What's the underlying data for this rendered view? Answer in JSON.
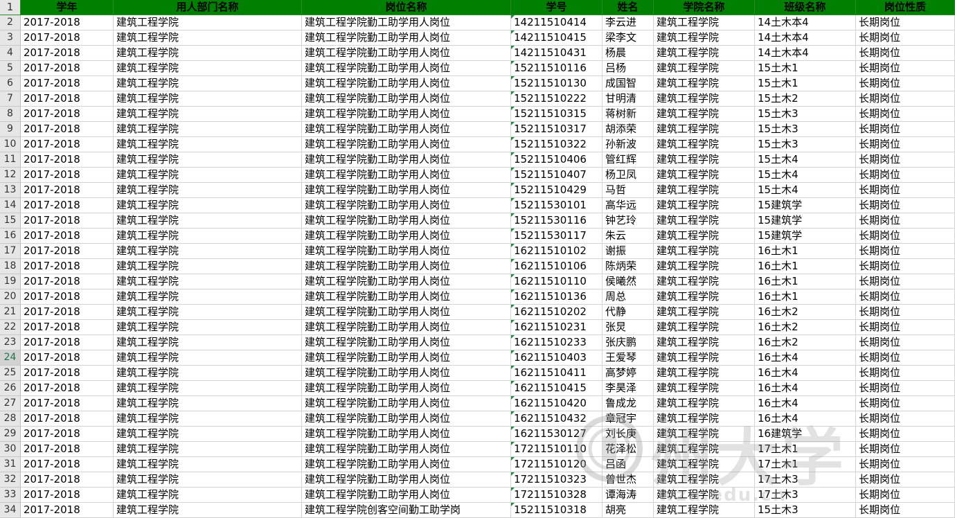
{
  "headers": [
    "学年",
    "用人部门名称",
    "岗位名称",
    "学号",
    "姓名",
    "学院名称",
    "班级名称",
    "岗位性质"
  ],
  "header_row_number": "1",
  "active_row_number": "24",
  "colors": {
    "header_bg": "#008000",
    "gridline": "#d4d4d4",
    "row_number_bg": "#e6e6e6"
  },
  "rows": [
    [
      "2",
      "2017-2018",
      "建筑工程学院",
      "建筑工程学院勤工助学用人岗位",
      "14211510414",
      "李云进",
      "建筑工程学院",
      "14土木本4",
      "长期岗位"
    ],
    [
      "3",
      "2017-2018",
      "建筑工程学院",
      "建筑工程学院勤工助学用人岗位",
      "14211510415",
      "梁李文",
      "建筑工程学院",
      "14土木本4",
      "长期岗位"
    ],
    [
      "4",
      "2017-2018",
      "建筑工程学院",
      "建筑工程学院勤工助学用人岗位",
      "14211510431",
      "杨晨",
      "建筑工程学院",
      "14土木本4",
      "长期岗位"
    ],
    [
      "5",
      "2017-2018",
      "建筑工程学院",
      "建筑工程学院勤工助学用人岗位",
      "15211510116",
      "吕杨",
      "建筑工程学院",
      "15土木1",
      "长期岗位"
    ],
    [
      "6",
      "2017-2018",
      "建筑工程学院",
      "建筑工程学院勤工助学用人岗位",
      "15211510130",
      "成国智",
      "建筑工程学院",
      "15土木1",
      "长期岗位"
    ],
    [
      "7",
      "2017-2018",
      "建筑工程学院",
      "建筑工程学院勤工助学用人岗位",
      "15211510222",
      "甘明清",
      "建筑工程学院",
      "15土木2",
      "长期岗位"
    ],
    [
      "8",
      "2017-2018",
      "建筑工程学院",
      "建筑工程学院勤工助学用人岗位",
      "15211510315",
      "蒋树新",
      "建筑工程学院",
      "15土木3",
      "长期岗位"
    ],
    [
      "9",
      "2017-2018",
      "建筑工程学院",
      "建筑工程学院勤工助学用人岗位",
      "15211510317",
      "胡添荣",
      "建筑工程学院",
      "15土木3",
      "长期岗位"
    ],
    [
      "10",
      "2017-2018",
      "建筑工程学院",
      "建筑工程学院勤工助学用人岗位",
      "15211510322",
      "孙新波",
      "建筑工程学院",
      "15土木3",
      "长期岗位"
    ],
    [
      "11",
      "2017-2018",
      "建筑工程学院",
      "建筑工程学院勤工助学用人岗位",
      "15211510406",
      "管红辉",
      "建筑工程学院",
      "15土木4",
      "长期岗位"
    ],
    [
      "12",
      "2017-2018",
      "建筑工程学院",
      "建筑工程学院勤工助学用人岗位",
      "15211510407",
      "杨卫凤",
      "建筑工程学院",
      "15土木4",
      "长期岗位"
    ],
    [
      "13",
      "2017-2018",
      "建筑工程学院",
      "建筑工程学院勤工助学用人岗位",
      "15211510429",
      "马哲",
      "建筑工程学院",
      "15土木4",
      "长期岗位"
    ],
    [
      "14",
      "2017-2018",
      "建筑工程学院",
      "建筑工程学院勤工助学用人岗位",
      "15211530101",
      "高华远",
      "建筑工程学院",
      "15建筑学",
      "长期岗位"
    ],
    [
      "15",
      "2017-2018",
      "建筑工程学院",
      "建筑工程学院勤工助学用人岗位",
      "15211530116",
      "钟艺玲",
      "建筑工程学院",
      "15建筑学",
      "长期岗位"
    ],
    [
      "16",
      "2017-2018",
      "建筑工程学院",
      "建筑工程学院勤工助学用人岗位",
      "15211530117",
      "朱云",
      "建筑工程学院",
      "15建筑学",
      "长期岗位"
    ],
    [
      "17",
      "2017-2018",
      "建筑工程学院",
      "建筑工程学院勤工助学用人岗位",
      "16211510102",
      "谢振",
      "建筑工程学院",
      "16土木1",
      "长期岗位"
    ],
    [
      "18",
      "2017-2018",
      "建筑工程学院",
      "建筑工程学院勤工助学用人岗位",
      "16211510106",
      "陈炳荣",
      "建筑工程学院",
      "16土木1",
      "长期岗位"
    ],
    [
      "19",
      "2017-2018",
      "建筑工程学院",
      "建筑工程学院勤工助学用人岗位",
      "16211510110",
      "侯曦然",
      "建筑工程学院",
      "16土木1",
      "长期岗位"
    ],
    [
      "20",
      "2017-2018",
      "建筑工程学院",
      "建筑工程学院勤工助学用人岗位",
      "16211510136",
      "周总",
      "建筑工程学院",
      "16土木1",
      "长期岗位"
    ],
    [
      "21",
      "2017-2018",
      "建筑工程学院",
      "建筑工程学院勤工助学用人岗位",
      "16211510202",
      "代静",
      "建筑工程学院",
      "16土木2",
      "长期岗位"
    ],
    [
      "22",
      "2017-2018",
      "建筑工程学院",
      "建筑工程学院勤工助学用人岗位",
      "16211510231",
      "张炅",
      "建筑工程学院",
      "16土木2",
      "长期岗位"
    ],
    [
      "23",
      "2017-2018",
      "建筑工程学院",
      "建筑工程学院勤工助学用人岗位",
      "16211510233",
      "张庆鹏",
      "建筑工程学院",
      "16土木2",
      "长期岗位"
    ],
    [
      "24",
      "2017-2018",
      "建筑工程学院",
      "建筑工程学院勤工助学用人岗位",
      "16211510403",
      "王爱琴",
      "建筑工程学院",
      "16土木4",
      "长期岗位"
    ],
    [
      "25",
      "2017-2018",
      "建筑工程学院",
      "建筑工程学院勤工助学用人岗位",
      "16211510411",
      "高梦婷",
      "建筑工程学院",
      "16土木4",
      "长期岗位"
    ],
    [
      "26",
      "2017-2018",
      "建筑工程学院",
      "建筑工程学院勤工助学用人岗位",
      "16211510415",
      "李昊泽",
      "建筑工程学院",
      "16土木4",
      "长期岗位"
    ],
    [
      "27",
      "2017-2018",
      "建筑工程学院",
      "建筑工程学院勤工助学用人岗位",
      "16211510420",
      "鲁成龙",
      "建筑工程学院",
      "16土木4",
      "长期岗位"
    ],
    [
      "28",
      "2017-2018",
      "建筑工程学院",
      "建筑工程学院勤工助学用人岗位",
      "16211510432",
      "章冠宇",
      "建筑工程学院",
      "16土木4",
      "长期岗位"
    ],
    [
      "29",
      "2017-2018",
      "建筑工程学院",
      "建筑工程学院勤工助学用人岗位",
      "16211530127",
      "刘长庚",
      "建筑工程学院",
      "16建筑学",
      "长期岗位"
    ],
    [
      "30",
      "2017-2018",
      "建筑工程学院",
      "建筑工程学院勤工助学用人岗位",
      "17211510110",
      "花泽松",
      "建筑工程学院",
      "17土木1",
      "长期岗位"
    ],
    [
      "31",
      "2017-2018",
      "建筑工程学院",
      "建筑工程学院勤工助学用人岗位",
      "17211510120",
      "吕函",
      "建筑工程学院",
      "17土木1",
      "长期岗位"
    ],
    [
      "32",
      "2017-2018",
      "建筑工程学院",
      "建筑工程学院勤工助学用人岗位",
      "17211510323",
      "曾世杰",
      "建筑工程学院",
      "17土木3",
      "长期岗位"
    ],
    [
      "33",
      "2017-2018",
      "建筑工程学院",
      "建筑工程学院勤工助学用人岗位",
      "17211510328",
      "谭海涛",
      "建筑工程学院",
      "17土木3",
      "长期岗位"
    ],
    [
      "34",
      "2017-2018",
      "建筑工程学院",
      "建筑工程学院创客空间勤工助学岗",
      "15211510318",
      "胡亮",
      "建筑工程学院",
      "15土木3",
      "长期岗位"
    ]
  ],
  "watermark": {
    "text": "州大学",
    "url": "wzu.edu.cn"
  }
}
